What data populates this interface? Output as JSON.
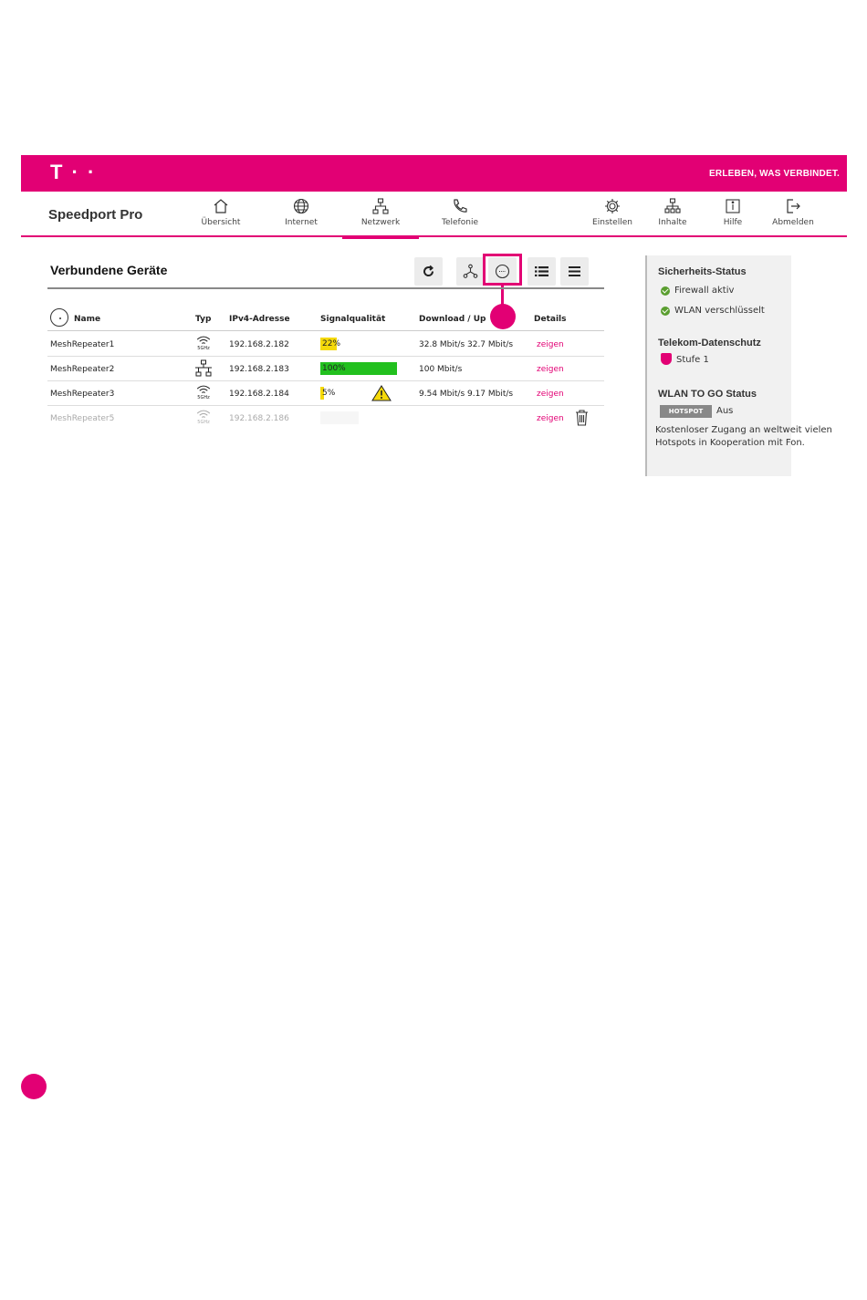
{
  "brand": {
    "logo": "T · ·",
    "tagline": "ERLEBEN, WAS VERBINDET."
  },
  "header": {
    "product": "Speedport Pro"
  },
  "nav_left": [
    {
      "label": "Übersicht",
      "icon": "home-icon"
    },
    {
      "label": "Internet",
      "icon": "globe-icon"
    },
    {
      "label": "Netzwerk",
      "icon": "network-icon",
      "active": true
    },
    {
      "label": "Telefonie",
      "icon": "phone-icon"
    }
  ],
  "nav_right": [
    {
      "label": "Einstellen",
      "icon": "gear-icon"
    },
    {
      "label": "Inhalte",
      "icon": "content-icon"
    },
    {
      "label": "Hilfe",
      "icon": "info-icon"
    },
    {
      "label": "Abmelden",
      "icon": "logout-icon"
    }
  ],
  "panel": {
    "title": "Verbundene Geräte",
    "tools": [
      "refresh-icon",
      "topology-icon",
      "ellipsis-icon",
      "list-icon",
      "menu-icon"
    ]
  },
  "table": {
    "headers": {
      "name": "Name",
      "type": "Typ",
      "ip": "IPv4-Adresse",
      "signal": "Signalqualität",
      "speed": "Download / Up",
      "details": "Details"
    },
    "rows": [
      {
        "name": "MeshRepeater1",
        "type": "wifi-5ghz",
        "type_label": "5GHz",
        "ip": "192.168.2.182",
        "signal": "22%",
        "signal_level": 22,
        "signal_color": "#f5d90a",
        "speed": "32.8 Mbit/s 32.7 Mbit/s",
        "details": "zeigen"
      },
      {
        "name": "MeshRepeater2",
        "type": "lan",
        "type_label": "",
        "ip": "192.168.2.183",
        "signal": "100%",
        "signal_level": 100,
        "signal_color": "#22c01e",
        "speed": "100 Mbit/s",
        "details": "zeigen"
      },
      {
        "name": "MeshRepeater3",
        "type": "wifi-5ghz",
        "type_label": "5GHz",
        "ip": "192.168.2.184",
        "signal": "5%",
        "signal_level": 5,
        "signal_color": "#f5d90a",
        "speed": "9.54 Mbit/s 9.17 Mbit/s",
        "details": "zeigen",
        "warning": true
      },
      {
        "name": "MeshRepeater5",
        "type": "wifi-5ghz",
        "type_label": "5GHz",
        "ip": "192.168.2.186",
        "signal": "",
        "signal_level": 0,
        "signal_color": "#f0f0f0",
        "speed": "",
        "details": "zeigen",
        "inactive": true,
        "deletable": true
      }
    ]
  },
  "sidebar": {
    "security_title": "Sicherheits-Status",
    "firewall": "Firewall aktiv",
    "wlan": "WLAN verschlüsselt",
    "privacy_title": "Telekom-Datenschutz",
    "privacy_level": "Stufe 1",
    "hotspot_title": "WLAN TO GO Status",
    "hotspot_badge": "HOTSPOT",
    "hotspot_state": "Aus",
    "hotspot_desc": "Kostenloser Zugang an weltweit vielen Hotspots in Kooperation mit Fon."
  },
  "colors": {
    "magenta": "#e20074",
    "ok_green": "#5a9e2f"
  }
}
